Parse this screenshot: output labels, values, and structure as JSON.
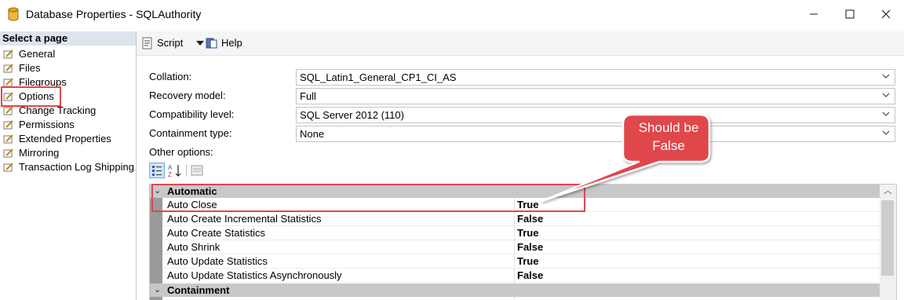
{
  "window": {
    "title": "Database Properties - SQLAuthority"
  },
  "sidebar": {
    "header": "Select a page",
    "items": [
      {
        "label": "General"
      },
      {
        "label": "Files"
      },
      {
        "label": "Filegroups"
      },
      {
        "label": "Options",
        "selected": true
      },
      {
        "label": "Change Tracking"
      },
      {
        "label": "Permissions"
      },
      {
        "label": "Extended Properties"
      },
      {
        "label": "Mirroring"
      },
      {
        "label": "Transaction Log Shipping"
      }
    ]
  },
  "toolbar": {
    "script_label": "Script",
    "help_label": "Help"
  },
  "form": {
    "collation_label": "Collation:",
    "collation_value": "SQL_Latin1_General_CP1_CI_AS",
    "recovery_label": "Recovery model:",
    "recovery_value": "Full",
    "compat_label": "Compatibility level:",
    "compat_value": "SQL Server 2012 (110)",
    "containment_label": "Containment type:",
    "containment_value": "None",
    "other_options_label": "Other options:"
  },
  "grid": {
    "categories": [
      {
        "name": "Automatic",
        "rows": [
          {
            "name": "Auto Close",
            "value": "True"
          },
          {
            "name": "Auto Create Incremental Statistics",
            "value": "False"
          },
          {
            "name": "Auto Create Statistics",
            "value": "True"
          },
          {
            "name": "Auto Shrink",
            "value": "False"
          },
          {
            "name": "Auto Update Statistics",
            "value": "True"
          },
          {
            "name": "Auto Update Statistics Asynchronously",
            "value": "False"
          }
        ]
      },
      {
        "name": "Containment",
        "rows": []
      }
    ]
  },
  "callout": {
    "line1": "Should be",
    "line2": "False"
  },
  "colors": {
    "highlight": "#e0474c",
    "category_bg": "#c8c8c8",
    "sidebar_header": "#dde4ee"
  }
}
